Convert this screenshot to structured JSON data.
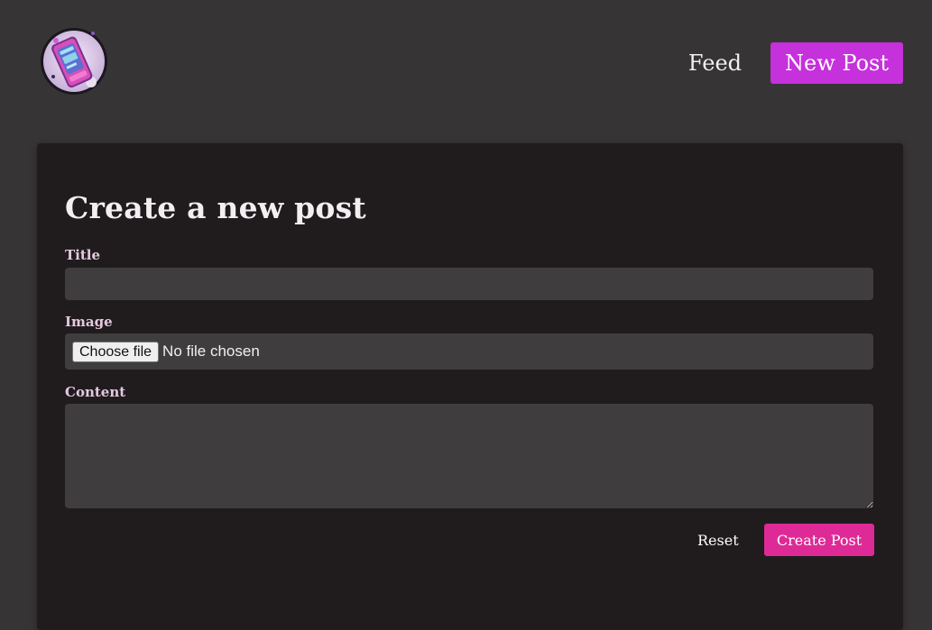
{
  "header": {
    "logo_icon": "phone-sticker-logo-icon",
    "nav": {
      "feed_label": "Feed",
      "new_post_label": "New Post"
    }
  },
  "form": {
    "heading": "Create a new post",
    "title_label": "Title",
    "title_value": "",
    "image_label": "Image",
    "file_button_label": "Choose file",
    "file_status": "No file chosen",
    "content_label": "Content",
    "content_value": "",
    "reset_label": "Reset",
    "submit_label": "Create Post"
  },
  "colors": {
    "background": "#373435",
    "card": "#201c1e",
    "input": "#403d3f",
    "nav_active": "#c531db",
    "primary_button": "#de2a96",
    "label": "#e5c8df"
  }
}
